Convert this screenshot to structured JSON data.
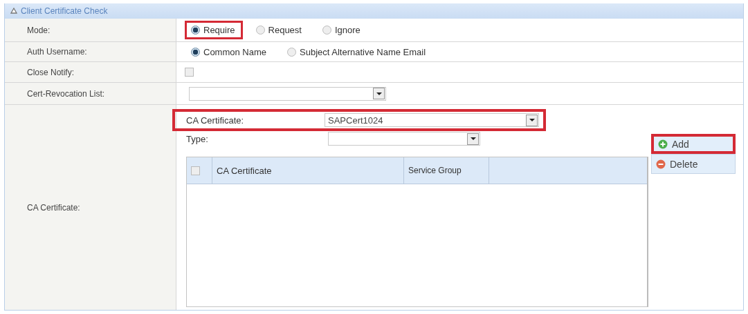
{
  "panel": {
    "title": "Client Certificate Check",
    "expanded": true
  },
  "mode": {
    "label": "Mode:",
    "options": [
      {
        "label": "Require",
        "selected": true,
        "highlighted": true
      },
      {
        "label": "Request",
        "selected": false,
        "highlighted": false
      },
      {
        "label": "Ignore",
        "selected": false,
        "highlighted": false
      }
    ]
  },
  "auth_username": {
    "label": "Auth Username:",
    "options": [
      {
        "label": "Common Name",
        "selected": true
      },
      {
        "label": "Subject Alternative Name Email",
        "selected": false
      }
    ]
  },
  "close_notify": {
    "label": "Close Notify:",
    "checked": false
  },
  "cert_revocation_list": {
    "label": "Cert-Revocation List:"
  },
  "ca_certificate": {
    "label": "CA Certificate:",
    "selector": {
      "label": "CA Certificate:",
      "value": "SAPCert1024",
      "highlighted": true
    },
    "type": {
      "label": "Type:"
    },
    "table": {
      "select_all": false,
      "columns": [
        "CA Certificate",
        "Service Group"
      ]
    },
    "buttons": [
      {
        "label": "Add",
        "kind": "add",
        "highlighted": true
      },
      {
        "label": "Delete",
        "kind": "delete",
        "highlighted": false
      }
    ]
  }
}
